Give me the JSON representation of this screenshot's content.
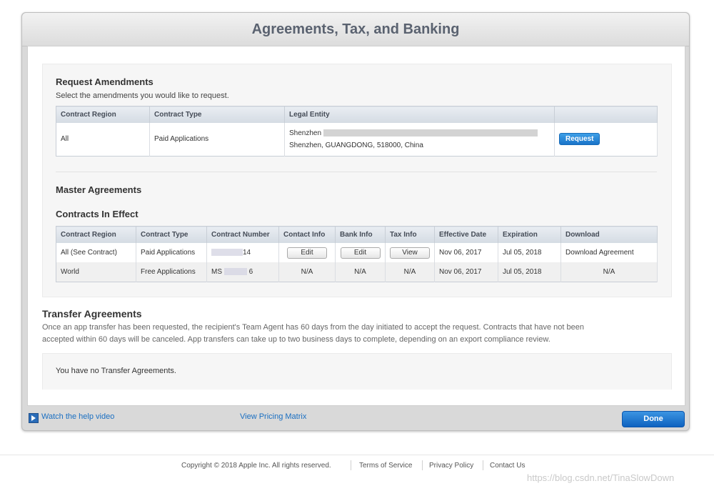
{
  "dialog": {
    "title": "Agreements, Tax, and Banking"
  },
  "request_amendments": {
    "title": "Request Amendments",
    "subtitle": "Select the amendments you would like to request.",
    "headers": [
      "Contract Region",
      "Contract Type",
      "Legal Entity"
    ],
    "row": {
      "region": "All",
      "type": "Paid Applications",
      "entity_line1": "Shenzhen",
      "entity_line2": "Shenzhen, GUANGDONG, 518000, China",
      "button": "Request"
    }
  },
  "master": {
    "title": "Master Agreements"
  },
  "contracts": {
    "title": "Contracts In Effect",
    "headers": [
      "Contract Region",
      "Contract Type",
      "Contract Number",
      "Contact Info",
      "Bank Info",
      "Tax Info",
      "Effective Date",
      "Expiration",
      "Download"
    ],
    "rows": [
      {
        "region": "All (See Contract)",
        "type": "Paid Applications",
        "number_tail": "14",
        "contact": "Edit",
        "bank": "Edit",
        "tax": "View",
        "effective": "Nov 06, 2017",
        "expiration": "Jul 05, 2018",
        "download": "Download Agreement"
      },
      {
        "region": "World",
        "type": "Free Applications",
        "number_head": "MS",
        "number_tail": "6",
        "contact": "N/A",
        "bank": "N/A",
        "tax": "N/A",
        "effective": "Nov 06, 2017",
        "expiration": "Jul 05, 2018",
        "download": "N/A"
      }
    ]
  },
  "transfer": {
    "title": "Transfer Agreements",
    "text_line1": "Once an app transfer has been requested, the recipient's Team Agent has 60 days from the day initiated to accept the request. Contracts that have not been",
    "text_line2": "accepted within 60 days will be canceled. App transfers can take up to two business days to complete, depending on an export compliance review.",
    "empty": "You have no Transfer Agreements."
  },
  "footer_bar": {
    "help_video": "Watch the help video",
    "pricing": "View Pricing Matrix",
    "done": "Done"
  },
  "page_footer": {
    "copyright": "Copyright © 2018 Apple Inc. All rights reserved.",
    "terms": "Terms of Service",
    "privacy": "Privacy Policy",
    "contact": "Contact Us",
    "watermark": "https://blog.csdn.net/TinaSlowDown"
  }
}
